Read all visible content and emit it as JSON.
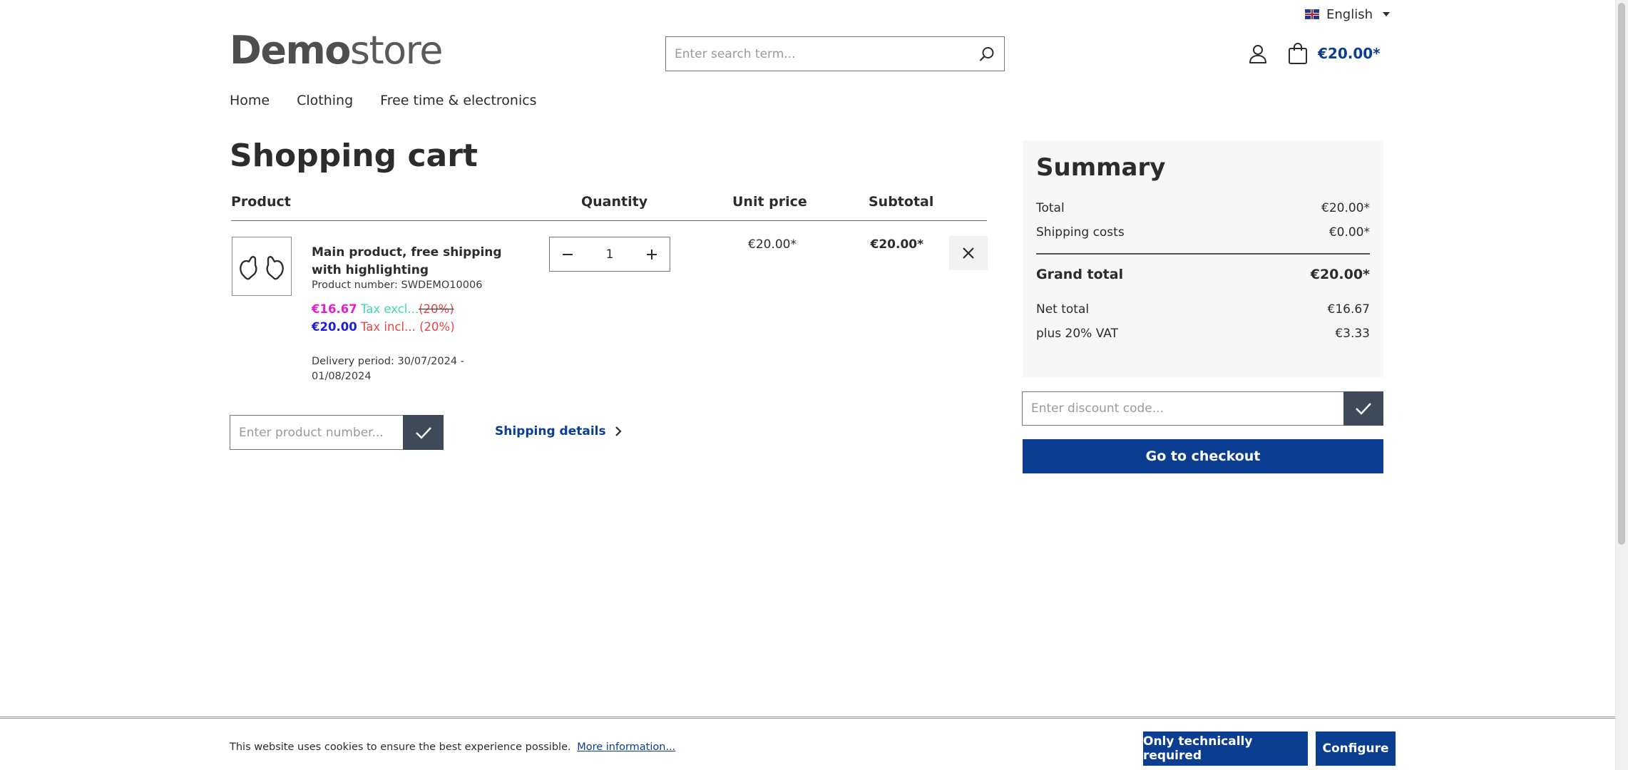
{
  "language": {
    "selected": "English"
  },
  "header": {
    "logo_bold": "Demo",
    "logo_light": "store",
    "search_placeholder": "Enter search term...",
    "cart_total": "€20.00*"
  },
  "nav": {
    "items": [
      "Home",
      "Clothing",
      "Free time & electronics"
    ]
  },
  "cart": {
    "title": "Shopping cart",
    "columns": {
      "product": "Product",
      "quantity": "Quantity",
      "unit_price": "Unit price",
      "subtotal": "Subtotal"
    },
    "items": [
      {
        "name": "Main product, free shipping with highlighting",
        "product_number": "Product number: SWDEMO10006",
        "price_excl": "€16.67",
        "tax_excl_label": "Tax excl...",
        "tax_excl_rate": "(20%)",
        "price_incl": "€20.00",
        "tax_incl_label": "Tax incl...",
        "tax_incl_rate": "(20%)",
        "delivery": "Delivery period: 30/07/2024 - 01/08/2024",
        "quantity": "1",
        "unit_price": "€20.00*",
        "subtotal": "€20.00*"
      }
    ],
    "add_product_placeholder": "Enter product number...",
    "shipping_details": "Shipping details"
  },
  "summary": {
    "title": "Summary",
    "total_label": "Total",
    "total": "€20.00*",
    "shipping_label": "Shipping costs",
    "shipping": "€0.00*",
    "grand_label": "Grand total",
    "grand": "€20.00*",
    "net_label": "Net total",
    "net": "€16.67",
    "vat_label": "plus 20% VAT",
    "vat": "€3.33",
    "discount_placeholder": "Enter discount code...",
    "checkout": "Go to checkout"
  },
  "cookie": {
    "text": "This website uses cookies to ensure the best experience possible.",
    "more_info": "More information...",
    "technical": "Only technically required",
    "configure": "Configure"
  },
  "colors": {
    "primary": "#0b3d91",
    "dark_button": "#3e4a57",
    "price_excl": "#e020c8",
    "tax_excl": "#3cd8b0",
    "price_incl": "#1e1ed8",
    "tax_incl": "#e84545"
  }
}
